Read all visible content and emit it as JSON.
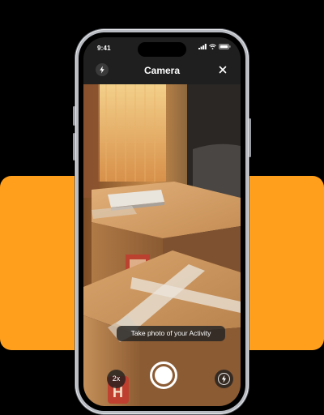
{
  "colors": {
    "accent": "#FF9F1C",
    "background": "#000000",
    "app_bar": "#1f1f1f"
  },
  "status_bar": {
    "time": "9:41",
    "icons": [
      "signal-icon",
      "wifi-icon",
      "battery-icon"
    ]
  },
  "header": {
    "title": "Camera",
    "left_icon": "flash-icon",
    "right_icon": "close-icon"
  },
  "camera": {
    "prompt": "Take photo of your Activity",
    "zoom_label": "2x",
    "shutter_icon": "shutter-button",
    "right_control_icon": "flash-icon"
  }
}
